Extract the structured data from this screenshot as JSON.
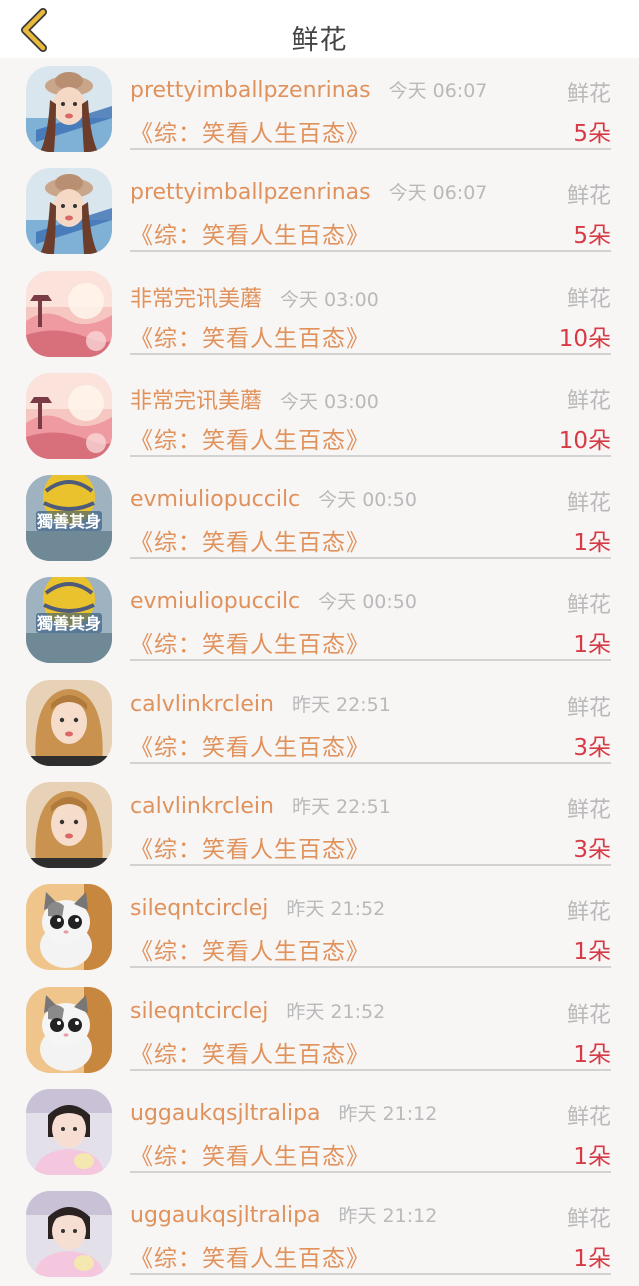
{
  "header": {
    "title": "鲜花",
    "back_icon": "back-chevron-icon",
    "accent": "#e8b93a"
  },
  "colors": {
    "name": "#e0925c",
    "count": "#d63a45",
    "muted": "#b9b9b9"
  },
  "gifts": [
    {
      "user": "prettyimballpzenrinas",
      "time": "今天 06:07",
      "type": "鲜花",
      "book": "《综：笑看人生百态》",
      "count": "5朵",
      "avatar": "girl-hat"
    },
    {
      "user": "prettyimballpzenrinas",
      "time": "今天 06:07",
      "type": "鲜花",
      "book": "《综：笑看人生百态》",
      "count": "5朵",
      "avatar": "girl-hat"
    },
    {
      "user": "非常完讯美蘑",
      "time": "今天 03:00",
      "type": "鲜花",
      "book": "《综：笑看人生百态》",
      "count": "10朵",
      "avatar": "pink-landscape"
    },
    {
      "user": "非常完讯美蘑",
      "time": "今天 03:00",
      "type": "鲜花",
      "book": "《综：笑看人生百态》",
      "count": "10朵",
      "avatar": "pink-landscape"
    },
    {
      "user": "evmiuliopuccilc",
      "time": "今天 00:50",
      "type": "鲜花",
      "book": "《综：笑看人生百态》",
      "count": "1朵",
      "avatar": "balloon"
    },
    {
      "user": "evmiuliopuccilc",
      "time": "今天 00:50",
      "type": "鲜花",
      "book": "《综：笑看人生百态》",
      "count": "1朵",
      "avatar": "balloon"
    },
    {
      "user": "calvlinkrclein",
      "time": "昨天 22:51",
      "type": "鲜花",
      "book": "《综：笑看人生百态》",
      "count": "3朵",
      "avatar": "blonde-girl"
    },
    {
      "user": "calvlinkrclein",
      "time": "昨天 22:51",
      "type": "鲜花",
      "book": "《综：笑看人生百态》",
      "count": "3朵",
      "avatar": "blonde-girl"
    },
    {
      "user": "sileqntcirclej",
      "time": "昨天 21:52",
      "type": "鲜花",
      "book": "《综：笑看人生百态》",
      "count": "1朵",
      "avatar": "kitten"
    },
    {
      "user": "sileqntcirclej",
      "time": "昨天 21:52",
      "type": "鲜花",
      "book": "《综：笑看人生百态》",
      "count": "1朵",
      "avatar": "kitten"
    },
    {
      "user": "uggaukqsjltralipa",
      "time": "昨天 21:12",
      "type": "鲜花",
      "book": "《综：笑看人生百态》",
      "count": "1朵",
      "avatar": "child"
    },
    {
      "user": "uggaukqsjltralipa",
      "time": "昨天 21:12",
      "type": "鲜花",
      "book": "《综：笑看人生百态》",
      "count": "1朵",
      "avatar": "child"
    }
  ]
}
